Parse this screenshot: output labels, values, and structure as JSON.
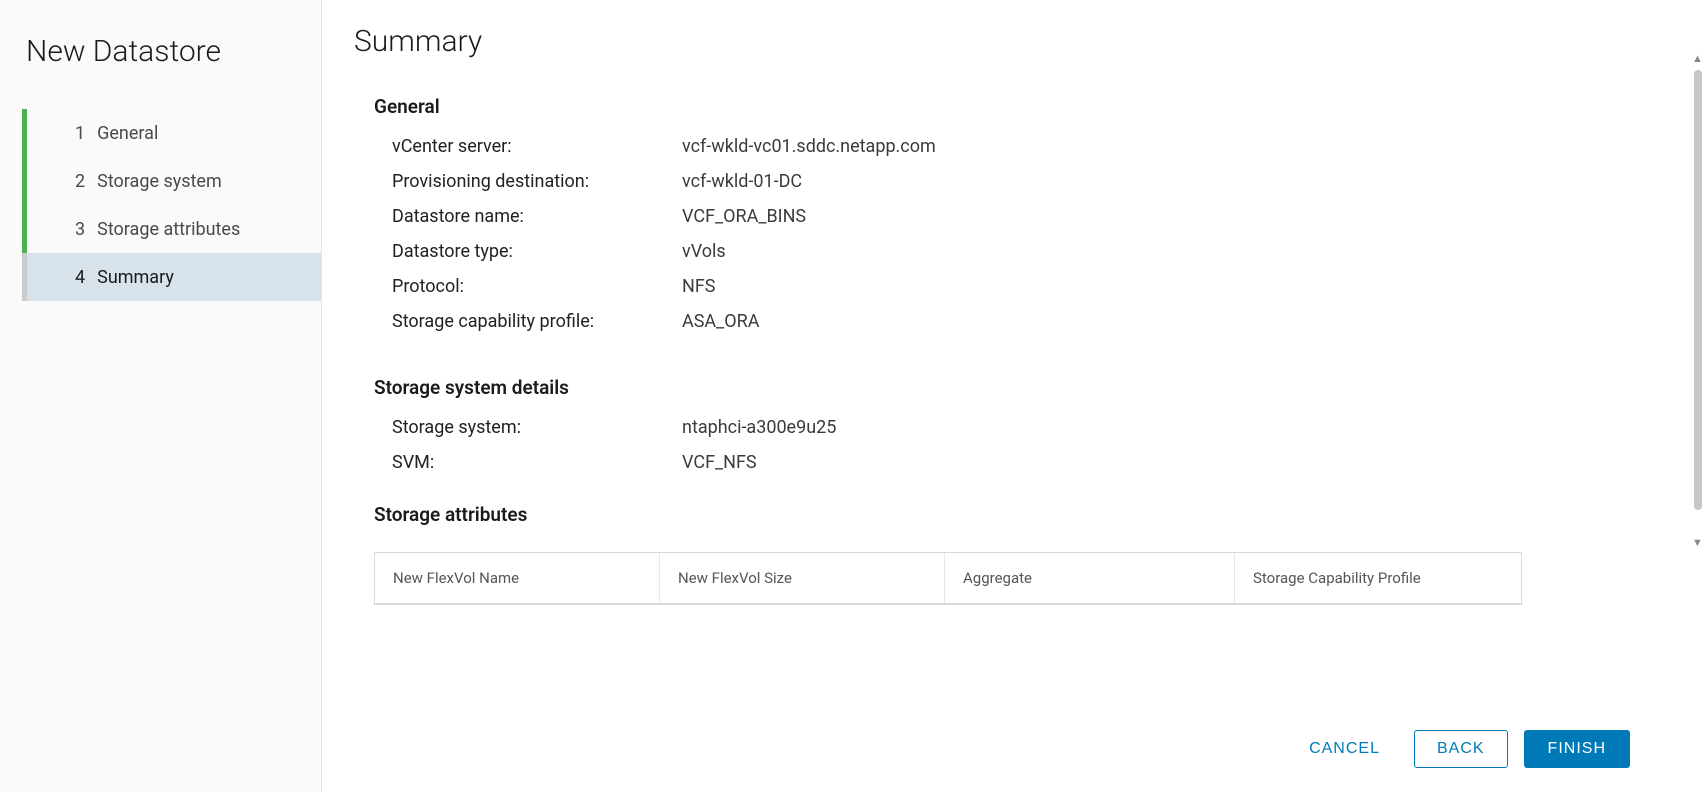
{
  "sidebar": {
    "title": "New Datastore",
    "steps": [
      {
        "num": "1",
        "label": "General"
      },
      {
        "num": "2",
        "label": "Storage system"
      },
      {
        "num": "3",
        "label": "Storage attributes"
      },
      {
        "num": "4",
        "label": "Summary"
      }
    ]
  },
  "main": {
    "title": "Summary",
    "sections": {
      "general": {
        "heading": "General",
        "fields": [
          {
            "label": "vCenter server:",
            "value": "vcf-wkld-vc01.sddc.netapp.com"
          },
          {
            "label": "Provisioning destination:",
            "value": "vcf-wkld-01-DC"
          },
          {
            "label": "Datastore name:",
            "value": "VCF_ORA_BINS"
          },
          {
            "label": "Datastore type:",
            "value": "vVols"
          },
          {
            "label": "Protocol:",
            "value": "NFS"
          },
          {
            "label": "Storage capability profile:",
            "value": "ASA_ORA"
          }
        ]
      },
      "storage_system": {
        "heading": "Storage system details",
        "fields": [
          {
            "label": "Storage system:",
            "value": "ntaphci-a300e9u25"
          },
          {
            "label": "SVM:",
            "value": "VCF_NFS"
          }
        ]
      },
      "storage_attributes": {
        "heading": "Storage attributes",
        "columns": [
          "New FlexVol Name",
          "New FlexVol Size",
          "Aggregate",
          "Storage Capability Profile"
        ]
      }
    }
  },
  "footer": {
    "cancel": "CANCEL",
    "back": "BACK",
    "finish": "FINISH"
  }
}
